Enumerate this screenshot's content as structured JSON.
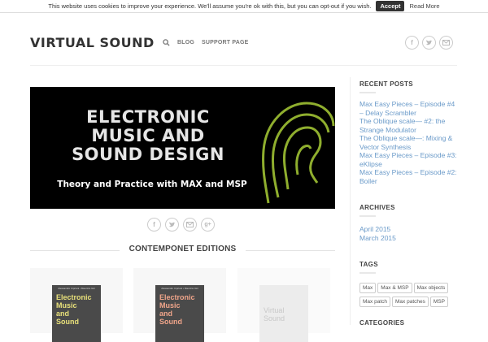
{
  "cookie": {
    "message": "This website uses cookies to improve your experience. We'll assume you're ok with this, but you can opt-out if you wish.",
    "accept_label": "Accept",
    "read_more_label": "Read More"
  },
  "header": {
    "logo": "VIRTUAL SOUND",
    "nav": [
      {
        "label": "BLOG"
      },
      {
        "label": "SUPPORT PAGE"
      }
    ],
    "social_icons": [
      "facebook-icon",
      "twitter-icon",
      "email-icon"
    ]
  },
  "banner": {
    "title_line1": "ELECTRONIC",
    "title_line2": "MUSIC AND",
    "title_line3": "SOUND DESIGN",
    "subtitle": "Theory and Practice with MAX and MSP"
  },
  "share_icons": [
    "facebook-icon",
    "twitter-icon",
    "email-icon",
    "google-plus-icon"
  ],
  "section": {
    "title": "CONTEMPONET EDITIONS"
  },
  "books": [
    {
      "authors": "Alessandro Cipriani • Maurizio Giri",
      "title_lines": [
        "Electronic",
        "Music",
        "and",
        "Sound"
      ],
      "cover_color": "#4a4a4a",
      "title_color": "#e8e07a"
    },
    {
      "authors": "Alessandro Cipriani • Maurizio Giri",
      "title_lines": [
        "Electronic",
        "Music",
        "and",
        "Sound"
      ],
      "cover_color": "#4a4a4a",
      "title_color": "#f0a58a"
    },
    {
      "authors": "",
      "title_lines": [
        "Virtual Sound"
      ],
      "cover_color": "#e9e9e9",
      "title_color": "#cfcfcf"
    }
  ],
  "sidebar": {
    "recent_posts_title": "RECENT POSTS",
    "recent_posts": [
      "Max Easy Pieces – Episode #4 – Delay Scrambler",
      "The Oblique scale— #2: the Strange Modulator",
      "The Oblique scale—: Mixing & Vector Synthesis",
      "Max Easy Pieces – Episode #3: eKlipse",
      "Max Easy Pieces – Episode #2: Boiler"
    ],
    "archives_title": "ARCHIVES",
    "archives": [
      "April 2015",
      "March 2015"
    ],
    "tags_title": "TAGS",
    "tags": [
      "Max",
      "Max & MSP",
      "Max objects",
      "Max patch",
      "Max patches",
      "MSP"
    ],
    "categories_title": "CATEGORIES"
  },
  "colors": {
    "link": "#6a9ac9",
    "banner_accent": "#8fae2e",
    "banner_bg": "#000000"
  }
}
